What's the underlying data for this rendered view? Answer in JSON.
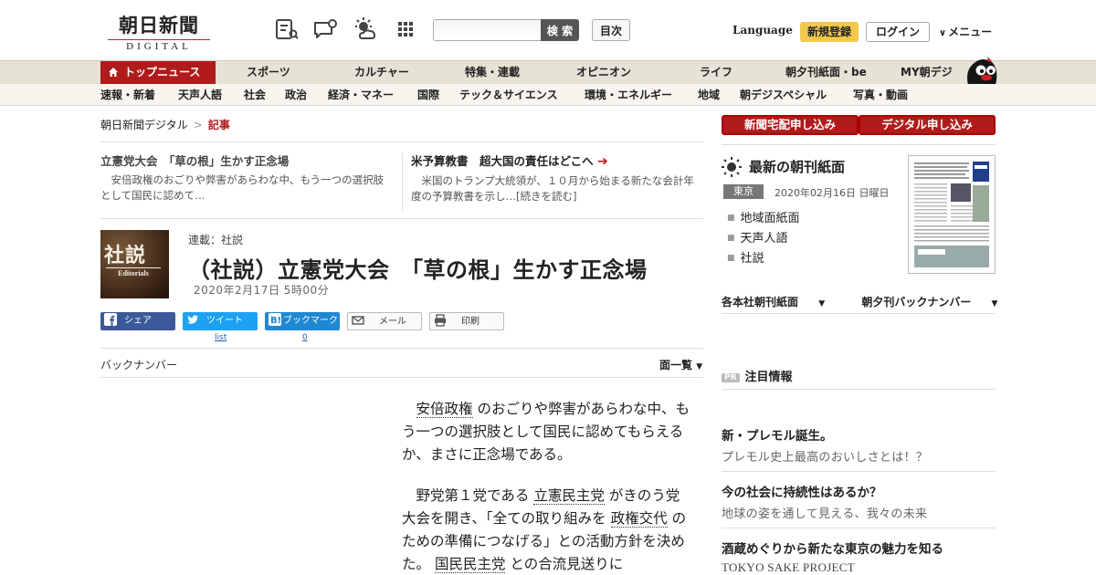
{
  "header": {
    "logo_jp": "朝日新聞",
    "logo_en": "DIGITAL",
    "search_button": "検 索",
    "search_placeholder": "",
    "toc_button": "目次",
    "language": "Language",
    "signup": "新規登録",
    "login": "ログイン",
    "menu": "メニュー",
    "icons": [
      "newspaper-search-icon",
      "message-icon",
      "weather-icon",
      "grid-icon"
    ]
  },
  "gnav": {
    "items": [
      "トップニュース",
      "スポーツ",
      "カルチャー",
      "特集・連載",
      "オピニオン",
      "ライフ",
      "朝夕刊紙面・be",
      "MY朝デジ"
    ]
  },
  "subnav": {
    "items": [
      "速報・新着",
      "天声人語",
      "社会",
      "政治",
      "経済・マネー",
      "国際",
      "テック＆サイエンス",
      "環境・エネルギー",
      "地域",
      "朝デジスペシャル",
      "写真・動画"
    ]
  },
  "breadcrumb": {
    "home": "朝日新聞デジタル",
    "sep": ">",
    "current": "記事"
  },
  "teasers": [
    {
      "title": "立憲党大会　「草の根」生かす正念場",
      "desc": "安倍政権のおごりや弊害があらわな中、もう一つの選択肢として国民に認めて…"
    },
    {
      "title": "米予算教書　超大国の責任はどこへ",
      "desc": "米国のトランプ大統領が、１０月から始まる新たな会計年度の予算教書を示し…[続きを読む]"
    }
  ],
  "article": {
    "thumb_kanji": "社説",
    "thumb_en": "Editorials",
    "series": "連載：社説",
    "headline": "（社説）立憲党大会　「草の根」生かす正念場",
    "date": "2020年2月17日 5時00分",
    "share": {
      "facebook": "シェア",
      "twitter": "ツイート",
      "twitter_count": "list",
      "hatena": "ブックマーク",
      "hatena_count": "0",
      "mail": "メール",
      "print": "印刷"
    },
    "back_number": "バックナンバー",
    "page_list": "面一覧",
    "p1": {
      "a": "安倍政権",
      "b": "のおごりや弊害があらわな中、もう一つの選択肢として国民に認めてもらえるか、まさに正念場である。"
    },
    "p2": {
      "a": "野党第１党である",
      "b": "立憲民主党",
      "c": "がきのう党大会を開き、「全ての取り組みを",
      "d": "政権交代",
      "e": "のための準備につなげる」との活動方針を決めた。",
      "f": "国民民主党",
      "g": "との合流見送りに"
    }
  },
  "sidebar": {
    "subscribe_paper": "新聞宅配申し込み",
    "subscribe_digital": "デジタル申し込み",
    "latest_title": "最新の朝刊紙面",
    "region": "東京",
    "paper_date": "2020年02月16日 日曜日",
    "links": [
      "地域面紙面",
      "天声人語",
      "社説"
    ],
    "menu_a": "各本社朝刊紙面",
    "menu_b": "朝夕刊バックナンバー",
    "pr_badge": "PR",
    "pr_title": "注目情報",
    "ads": [
      {
        "title": "新・プレモル誕生。",
        "desc": "プレモル史上最高のおいしさとは！？"
      },
      {
        "title": "今の社会に持続性はあるか？",
        "desc": "地球の姿を通して見える、我々の未来"
      },
      {
        "title": "酒蔵めぐりから新たな東京の魅力を知る",
        "desc": "TOKYO SAKE PROJECT"
      }
    ]
  },
  "colors": {
    "brand_red": "#b01b1b",
    "signup_yellow": "#f2c94c",
    "facebook": "#3b5998",
    "twitter": "#1da1f2",
    "hatena": "#1e88d3"
  }
}
